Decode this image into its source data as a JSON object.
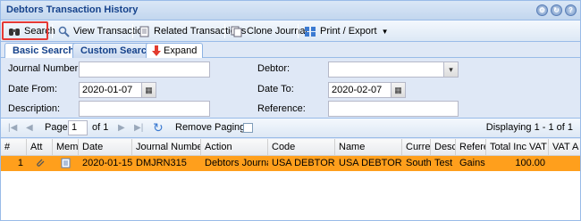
{
  "window": {
    "title": "Debtors Transaction History"
  },
  "toolbar": {
    "search": "Search",
    "view_transaction": "View Transaction",
    "related_transactions": "Related Transactions",
    "clone_journal": "Clone Journal",
    "print_export": "Print / Export"
  },
  "tabs": {
    "basic": "Basic Search",
    "custom": "Custom Search",
    "expand": "Expand"
  },
  "form": {
    "journal_number_label": "Journal Number:",
    "journal_number_value": "",
    "debtor_label": "Debtor:",
    "debtor_value": "",
    "date_from_label": "Date From:",
    "date_from_value": "2020-01-07",
    "date_to_label": "Date To:",
    "date_to_value": "2020-02-07",
    "description_label": "Description:",
    "description_value": "",
    "reference_label": "Reference:",
    "reference_value": ""
  },
  "pager": {
    "page_label": "Page",
    "page_value": "1",
    "of_label": "of 1",
    "remove_paging": "Remove Paging:",
    "displaying": "Displaying 1 - 1 of 1"
  },
  "grid": {
    "headers": [
      "#",
      "Att",
      "Memo",
      "Date",
      "Journal Number",
      "Action",
      "Code",
      "Name",
      "Curren",
      "Descrip",
      "Refere",
      "Total Inc VAT",
      "VAT A"
    ],
    "rows": [
      {
        "num": "1",
        "date": "2020-01-15",
        "journal": "DMJRN315",
        "action": "Debtors Journal De",
        "code": "USA DEBTOR",
        "name": "USA DEBTOR",
        "currency": "South A",
        "description": "Test",
        "reference": "Gains T",
        "total": "100.00",
        "vat": ""
      }
    ]
  },
  "colors": {
    "selected_row": "#ff9f1c",
    "panel": "#dfe8f6",
    "title": "#15428b",
    "highlight": "#e53935"
  }
}
